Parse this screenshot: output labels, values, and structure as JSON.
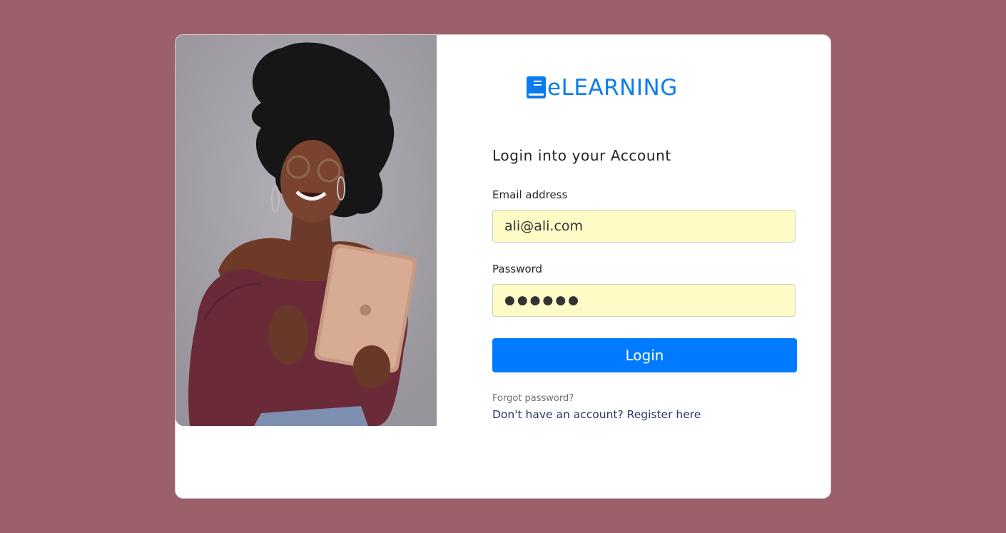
{
  "colors": {
    "page_background": "#9c606a",
    "brand": "#0a7cf0",
    "button": "#007bff",
    "input_background": "#fffbc7",
    "link": "#2a3562"
  },
  "hero_image": {
    "description_icon": "woman-with-tablet-photo"
  },
  "brand": {
    "icon": "book-icon",
    "text": "eLEARNING"
  },
  "form": {
    "heading": "Login into your Account",
    "email": {
      "label": "Email address",
      "value": "ali@ali.com"
    },
    "password": {
      "label": "Password",
      "value": "●●●●●●"
    },
    "submit_label": "Login",
    "forgot_label": "Forgot password?",
    "register_prompt": "Don't have an account?",
    "register_link": "Register here"
  }
}
